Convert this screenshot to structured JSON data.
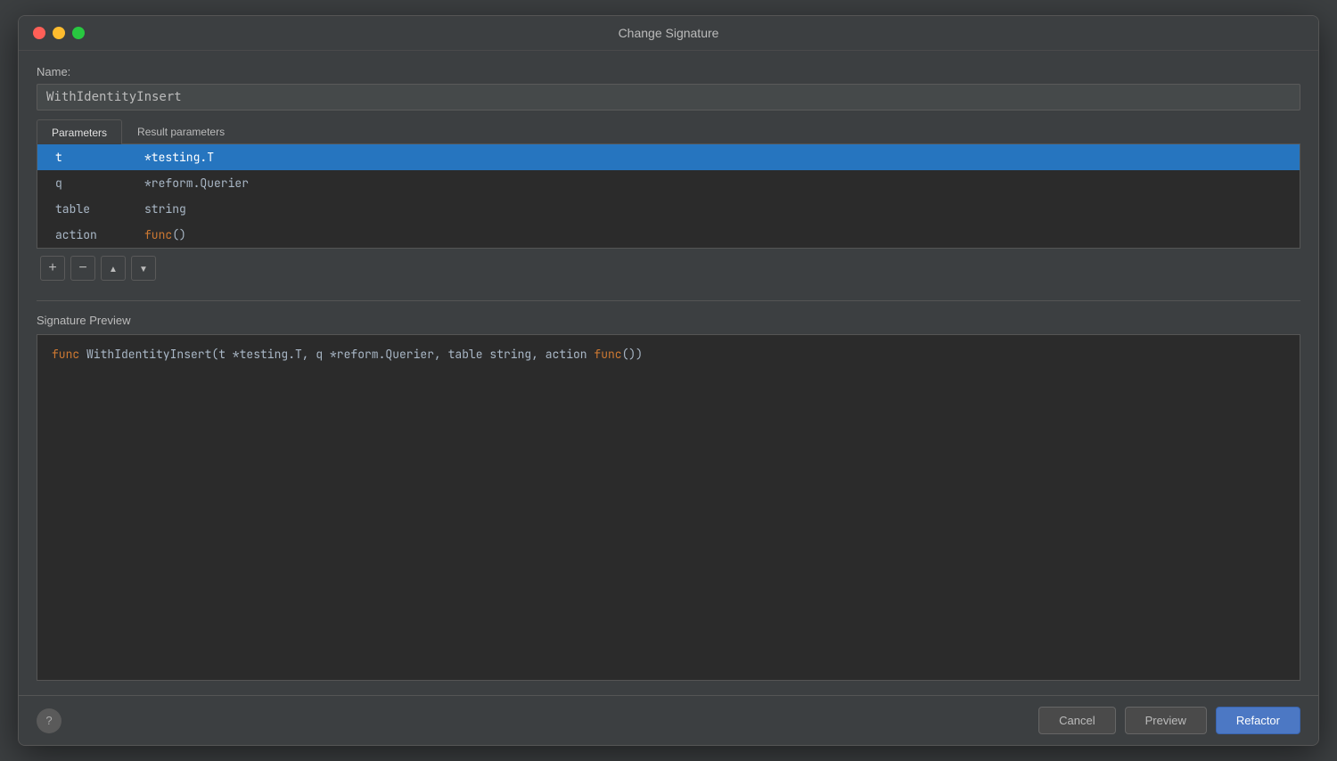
{
  "window": {
    "title": "Change Signature"
  },
  "name_section": {
    "label": "Name:",
    "value": "WithIdentityInsert"
  },
  "tabs": {
    "items": [
      {
        "id": "parameters",
        "label": "Parameters",
        "active": true
      },
      {
        "id": "result-parameters",
        "label": "Result parameters",
        "active": false
      }
    ]
  },
  "parameters": [
    {
      "name": "t",
      "type": "*testing.T",
      "selected": true
    },
    {
      "name": "q",
      "type": "*reform.Querier",
      "selected": false
    },
    {
      "name": "table",
      "type": "string",
      "selected": false
    },
    {
      "name": "action",
      "type_keyword": "func",
      "type_rest": "()",
      "selected": false
    }
  ],
  "toolbar": {
    "add_label": "+",
    "remove_label": "−",
    "move_up_label": "▲",
    "move_down_label": "▼"
  },
  "signature_preview": {
    "label": "Signature Preview",
    "func_keyword": "func",
    "function_name": " WithIdentityInsert(t *testing.T, q *reform.Querier, table string, action ",
    "action_keyword": "func",
    "closing": "())"
  },
  "footer": {
    "help_label": "?",
    "cancel_label": "Cancel",
    "preview_label": "Preview",
    "refactor_label": "Refactor"
  }
}
